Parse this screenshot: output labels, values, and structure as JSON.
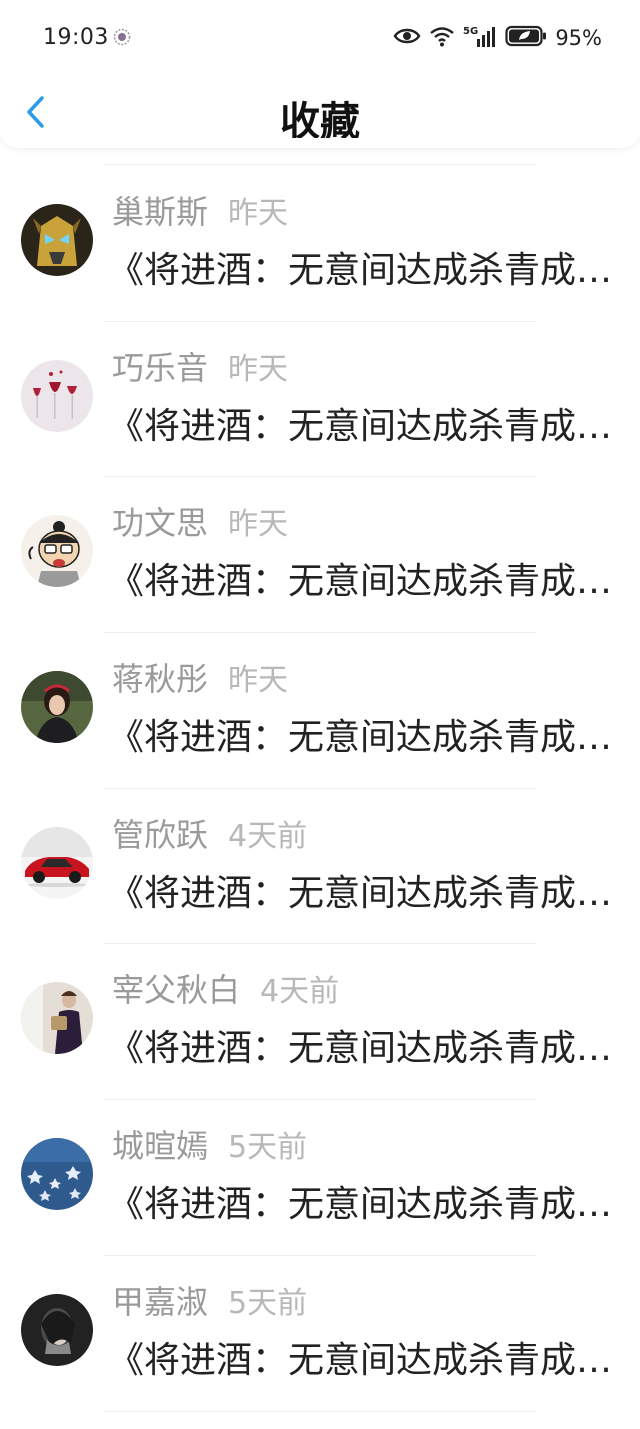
{
  "status_bar": {
    "time": "19:03",
    "battery": "95%",
    "signal": "5G"
  },
  "header": {
    "title": "收藏"
  },
  "items": [
    {
      "name": "巢斯斯",
      "time": "昨天",
      "title": "《将进酒：无意间达成杀青成就》",
      "avatar_icon": "robot-helmet-avatar",
      "avatar_color": "#3a2a10"
    },
    {
      "name": "巧乐音",
      "time": "昨天",
      "title": "《将进酒：无意间达成杀青成就》",
      "avatar_icon": "wine-glasses-avatar",
      "avatar_color": "#e8e0e4"
    },
    {
      "name": "功文思",
      "time": "昨天",
      "title": "《将进酒：无意间达成杀青成就》",
      "avatar_icon": "cartoon-boy-avatar",
      "avatar_color": "#f4f0ea"
    },
    {
      "name": "蒋秋彤",
      "time": "昨天",
      "title": "《将进酒：无意间达成杀青成就》",
      "avatar_icon": "girl-photo-avatar",
      "avatar_color": "#4a5a3a"
    },
    {
      "name": "管欣跃",
      "time": "4天前",
      "title": "《将进酒：无意间达成杀青成就》",
      "avatar_icon": "red-sports-car-avatar",
      "avatar_color": "#f2f2f2"
    },
    {
      "name": "宰父秋白",
      "time": "4天前",
      "title": "《将进酒：无意间达成杀青成就》",
      "avatar_icon": "person-with-bag-avatar",
      "avatar_color": "#ddd6cc"
    },
    {
      "name": "城暄嫣",
      "time": "5天前",
      "title": "《将进酒：无意间达成杀青成就》",
      "avatar_icon": "blue-lights-avatar",
      "avatar_color": "#2f5a8a"
    },
    {
      "name": "甲嘉淑",
      "time": "5天前",
      "title": "《将进酒：无意间达成杀青成就》",
      "avatar_icon": "dark-portrait-avatar",
      "avatar_color": "#2a2a2a"
    }
  ],
  "colors": {
    "accent": "#2c9be8",
    "name_text": "#9a9a9a",
    "time_text": "#b8b8b8",
    "title_text": "#222222"
  }
}
